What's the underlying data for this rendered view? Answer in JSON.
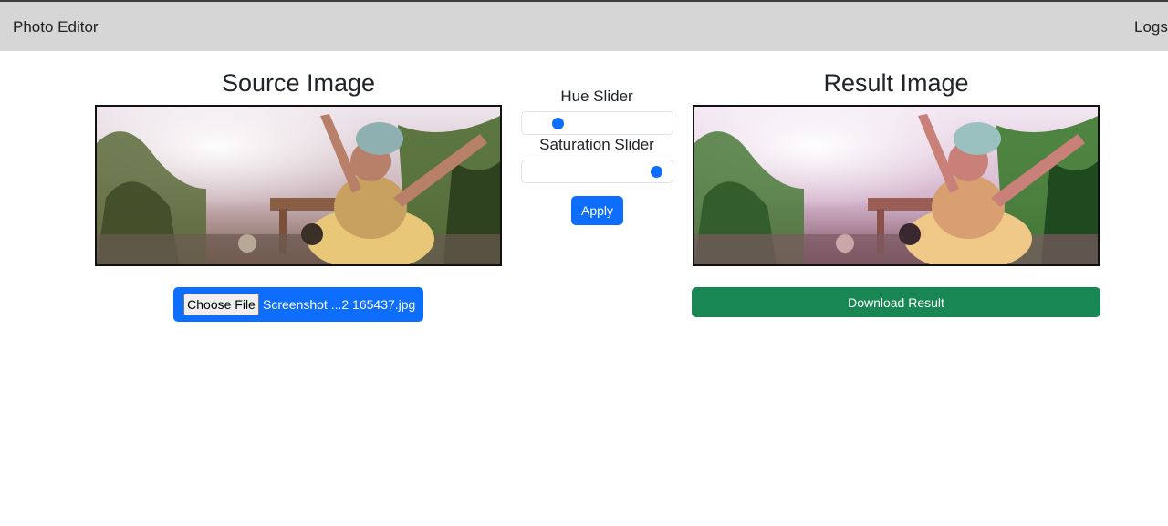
{
  "navbar": {
    "brand": "Photo Editor",
    "logout": "Logs"
  },
  "source": {
    "title": "Source Image"
  },
  "result": {
    "title": "Result Image",
    "download_label": "Download Result"
  },
  "controls": {
    "hue_label": "Hue Slider",
    "hue_value_fraction": 0.22,
    "saturation_label": "Saturation Slider",
    "saturation_value_fraction": 0.93,
    "apply_label": "Apply"
  },
  "file_input": {
    "button_label": "Choose File",
    "file_name": "Screenshot ...2 165437.jpg"
  },
  "colors": {
    "primary": "#0d6efd",
    "success": "#198754",
    "navbar_bg": "#d6d6d6"
  }
}
